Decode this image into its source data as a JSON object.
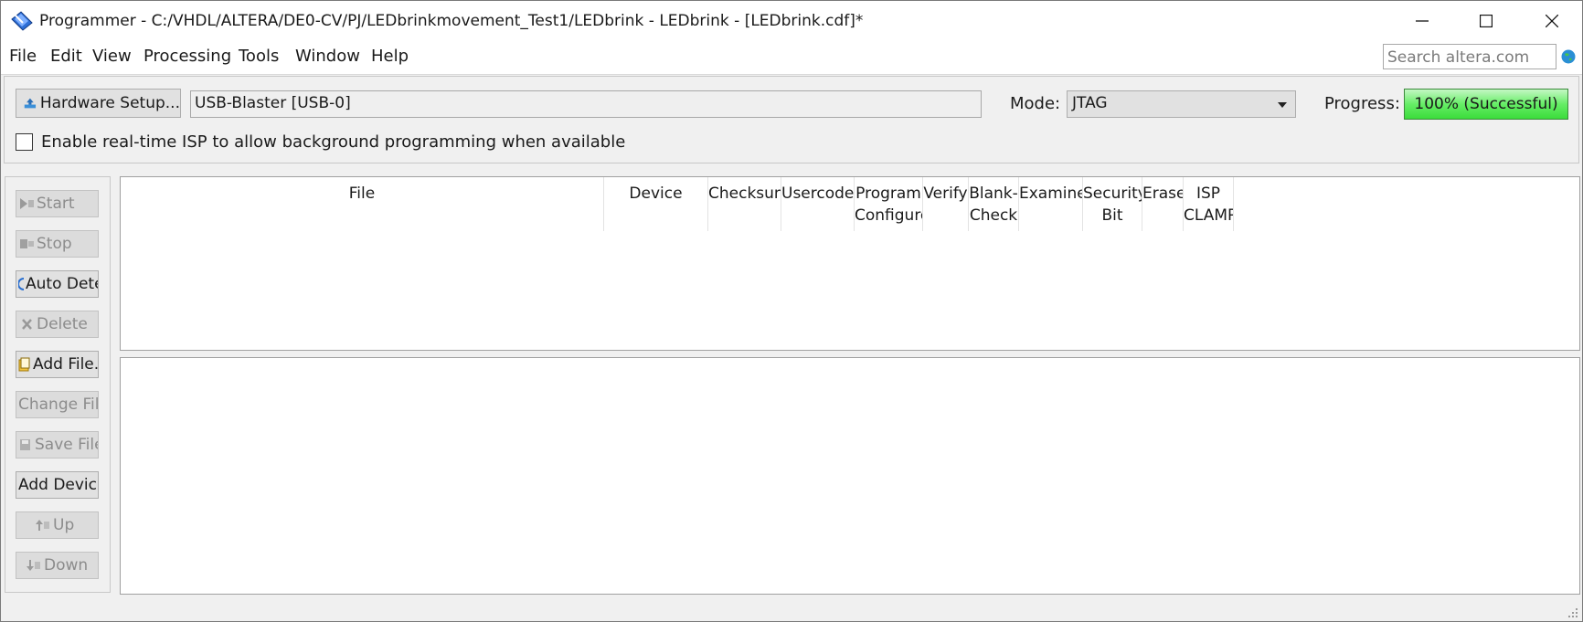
{
  "window": {
    "title": "Programmer - C:/VHDL/ALTERA/DE0-CV/PJ/LEDbrinkmovement_Test1/LEDbrink - LEDbrink - [LEDbrink.cdf]*",
    "minimize_label": "—",
    "maximize_label": "☐",
    "close_label": "✕"
  },
  "menu": {
    "items": [
      "File",
      "Edit",
      "View",
      "Processing",
      "Tools",
      "Window",
      "Help"
    ]
  },
  "search": {
    "placeholder": "Search altera.com"
  },
  "toolbar": {
    "hardware_setup_label": "Hardware Setup...",
    "hardware_value": "USB-Blaster [USB-0]",
    "mode_label": "Mode:",
    "mode_value": "JTAG",
    "progress_label": "Progress:",
    "progress_text": "100% (Successful)",
    "progress_value": 100,
    "progress_color": "#3bdc3b",
    "isp_checkbox_label": "Enable real-time ISP to allow background programming when available",
    "isp_checked": false
  },
  "side_buttons": [
    {
      "label": "Start",
      "icon": "start-icon",
      "enabled": false
    },
    {
      "label": "Stop",
      "icon": "stop-icon",
      "enabled": false
    },
    {
      "label": "Auto Dete",
      "icon": "auto-detect-icon",
      "enabled": true
    },
    {
      "label": "Delete",
      "icon": "delete-icon",
      "enabled": false
    },
    {
      "label": "Add File.",
      "icon": "add-file-icon",
      "enabled": true
    },
    {
      "label": "Change Fil",
      "icon": "",
      "enabled": false
    },
    {
      "label": "Save File",
      "icon": "save-file-icon",
      "enabled": false
    },
    {
      "label": "Add Devic",
      "icon": "",
      "enabled": true
    },
    {
      "label": "Up",
      "icon": "up-icon",
      "enabled": false
    },
    {
      "label": "Down",
      "icon": "down-icon",
      "enabled": false
    }
  ],
  "table": {
    "columns": [
      {
        "label": "File"
      },
      {
        "label": "Device"
      },
      {
        "label": "Checksun"
      },
      {
        "label": "Usercode"
      },
      {
        "label": "Program\nConfigure"
      },
      {
        "label": "Verify"
      },
      {
        "label": "Blank-\nCheck"
      },
      {
        "label": "Examine"
      },
      {
        "label": "Security\nBit"
      },
      {
        "label": "Erase"
      },
      {
        "label": "ISP\nCLAMP"
      }
    ],
    "rows": []
  }
}
